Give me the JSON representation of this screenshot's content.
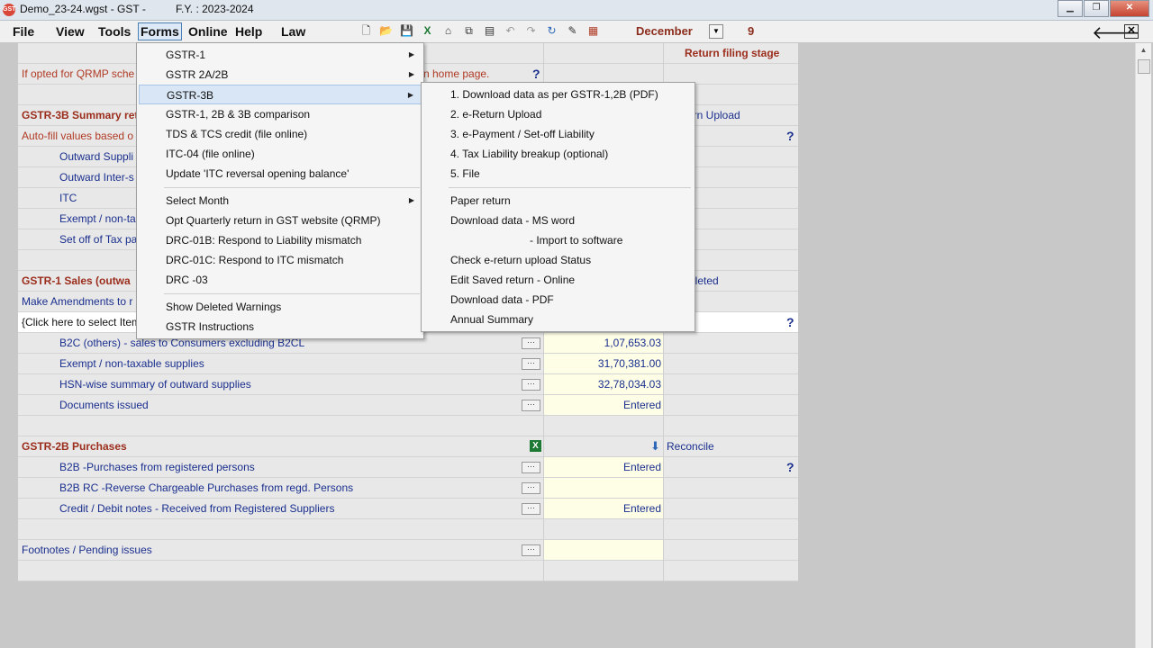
{
  "window": {
    "title": "Demo_23-24.wgst - GST -",
    "fy": "F.Y. : 2023-2024",
    "minimize": "▁",
    "restore": "❐",
    "close": "✕"
  },
  "menubar": {
    "items": [
      "File",
      "View",
      "Tools",
      "Forms",
      "Online",
      "Help",
      "Law"
    ],
    "active": "Forms"
  },
  "toolbar": {
    "month": "December",
    "day": "9",
    "back": "🡐",
    "close": "✕"
  },
  "table": {
    "return_filing_stage": "Return filing stage",
    "qrmp_note_prefix": "If opted for QRMP sche",
    "qrmp_note_suffix": "n home page.",
    "gstr3b_title": "GSTR-3B Summary ret",
    "return_upload": "urn Upload",
    "autofill": "Auto-fill values based o",
    "outward_supplies": "Outward Suppli",
    "outward_inter": "Outward Inter-s",
    "itc": "ITC",
    "exempt_short": "Exempt / non-ta",
    "setoff": "Set off of Tax pa",
    "gstr1_title": "GSTR-1   Sales (outwa",
    "deleted": "pleted",
    "amendments": "Make Amendments to r",
    "click_select": "{Click here to select Item",
    "b2c_others": "B2C (others) - sales to Consumers excluding B2CL",
    "b2c_value": "1,07,653.03",
    "exempt_supplies": "Exempt / non-taxable supplies",
    "exempt_value": "31,70,381.00",
    "hsn_summary": "HSN-wise summary of outward supplies",
    "hsn_value": "32,78,034.03",
    "documents_issued": "Documents issued",
    "documents_value": "Entered",
    "gstr2b_title": "GSTR-2B   Purchases",
    "reconcile": "Reconcile",
    "b2b_purchases": "B2B -Purchases from registered persons",
    "b2b_value": "Entered",
    "b2b_rc": "B2B RC -Reverse Chargeable Purchases from regd. Persons",
    "credit_debit": "Credit / Debit notes - Received from Registered Suppliers",
    "credit_value": "Entered",
    "footnotes": "Footnotes / Pending issues",
    "qmark": "?",
    "dots": "···"
  },
  "forms_menu": {
    "items": [
      "GSTR-1",
      "GSTR 2A/2B",
      "GSTR-3B",
      "GSTR-1, 2B & 3B comparison",
      "TDS & TCS credit (file online)",
      "ITC-04 (file online)",
      "Update 'ITC reversal opening balance'",
      "Select Month",
      "Opt Quarterly return in GST website (QRMP)",
      "DRC-01B: Respond to Liability mismatch",
      "DRC-01C: Respond to ITC mismatch",
      "DRC -03",
      "Show Deleted Warnings",
      "GSTR Instructions"
    ]
  },
  "gstr3b_submenu": {
    "items": [
      "1. Download data as per GSTR-1,2B (PDF)",
      "2. e-Return Upload",
      "3. e-Payment / Set-off Liability",
      "4. Tax Liability breakup (optional)",
      "5. File",
      "Paper return",
      "Download data - MS word",
      "- Import to software",
      "Check e-return upload Status",
      "Edit Saved return - Online",
      "Download data - PDF",
      "Annual Summary"
    ]
  },
  "colors": {
    "heading_red": "#9b2d1c",
    "link_blue": "#1a2f8e",
    "value_bg": "#fefee6",
    "highlight": "#d9e6f5"
  }
}
